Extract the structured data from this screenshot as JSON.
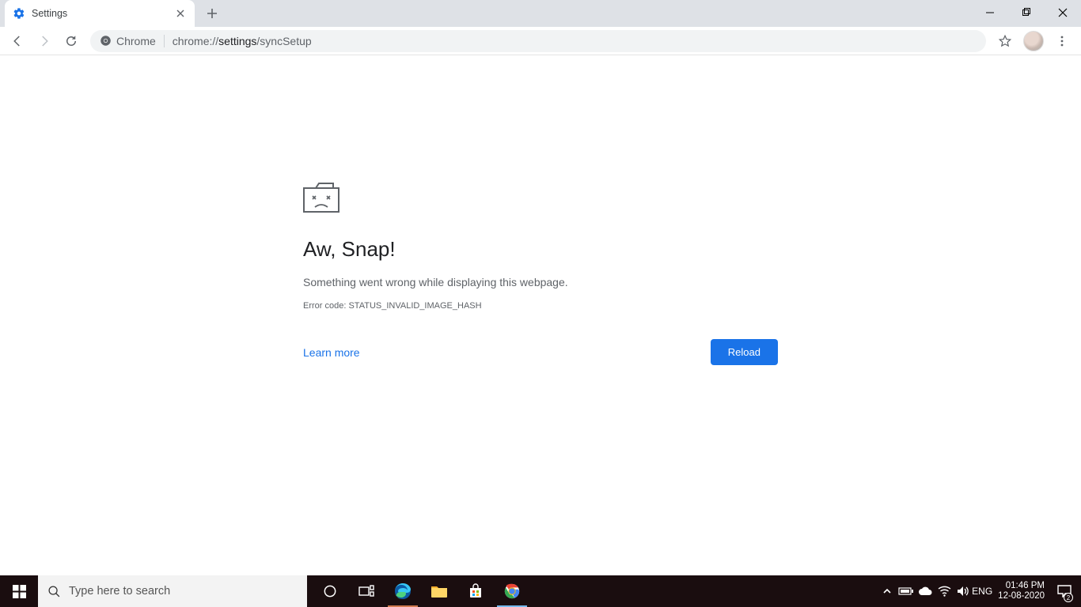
{
  "tab": {
    "title": "Settings"
  },
  "address": {
    "chip_label": "Chrome",
    "url_prefix": "chrome://",
    "url_path": "settings",
    "url_suffix": "/syncSetup"
  },
  "error": {
    "title": "Aw, Snap!",
    "message": "Something went wrong while displaying this webpage.",
    "code_label": "Error code: STATUS_INVALID_IMAGE_HASH",
    "learn_more": "Learn more",
    "reload": "Reload"
  },
  "taskbar": {
    "search_placeholder": "Type here to search",
    "lang": "ENG",
    "time": "01:46 PM",
    "date": "12-08-2020",
    "notif_count": "2"
  }
}
